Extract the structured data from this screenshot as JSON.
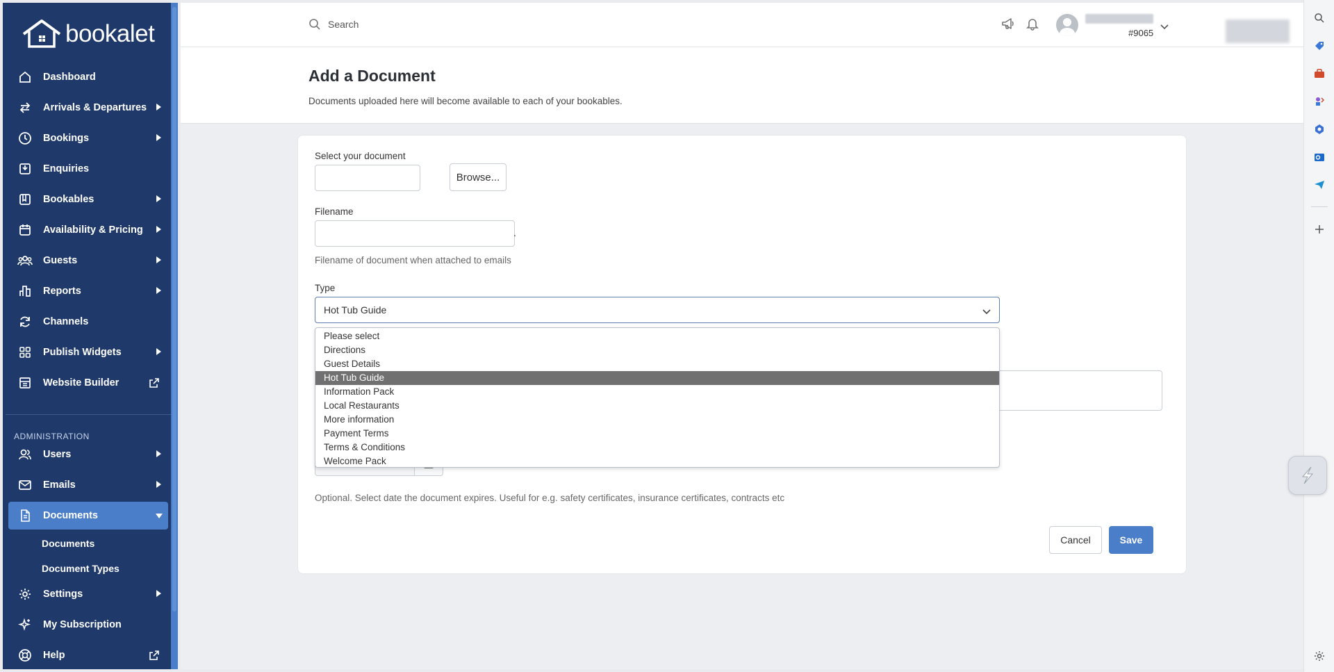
{
  "brand": {
    "logo_text": "bookalet"
  },
  "sidebar": {
    "items": [
      {
        "label": "Dashboard"
      },
      {
        "label": "Arrivals & Departures"
      },
      {
        "label": "Bookings"
      },
      {
        "label": "Enquiries"
      },
      {
        "label": "Bookables"
      },
      {
        "label": "Availability & Pricing"
      },
      {
        "label": "Guests"
      },
      {
        "label": "Reports"
      },
      {
        "label": "Channels"
      },
      {
        "label": "Publish Widgets"
      },
      {
        "label": "Website Builder"
      }
    ],
    "admin_label": "ADMINISTRATION",
    "admin_items": [
      {
        "label": "Users"
      },
      {
        "label": "Emails"
      },
      {
        "label": "Documents"
      }
    ],
    "documents_sub": [
      {
        "label": "Documents"
      },
      {
        "label": "Document Types"
      }
    ],
    "bottom_items": [
      {
        "label": "Settings"
      },
      {
        "label": "My Subscription"
      },
      {
        "label": "Help"
      }
    ]
  },
  "topbar": {
    "search_placeholder": "Search",
    "user_id": "#9065"
  },
  "page": {
    "title": "Add a Document",
    "subtitle": "Documents uploaded here will become available to each of your bookables."
  },
  "form": {
    "select_document_label": "Select your document",
    "browse_label": "Browse...",
    "filename_label": "Filename",
    "filename_value": "",
    "filename_hint": "Filename of document when attached to emails",
    "dot": ".",
    "type_label": "Type",
    "type_selected": "Hot Tub Guide",
    "type_options": [
      "Please select",
      "Directions",
      "Guest Details",
      "Hot Tub Guide",
      "Information Pack",
      "Local Restaurants",
      "More information",
      "Payment Terms",
      "Terms & Conditions",
      "Welcome Pack"
    ],
    "expiry_hint": "Optional. Select date the document expires. Useful for e.g. safety certificates, insurance certificates, contracts etc",
    "cancel_label": "Cancel",
    "save_label": "Save"
  },
  "colors": {
    "sidebar_bg": "#1f3a6a",
    "accent": "#4a7ec9",
    "selected_option": "#707070"
  }
}
